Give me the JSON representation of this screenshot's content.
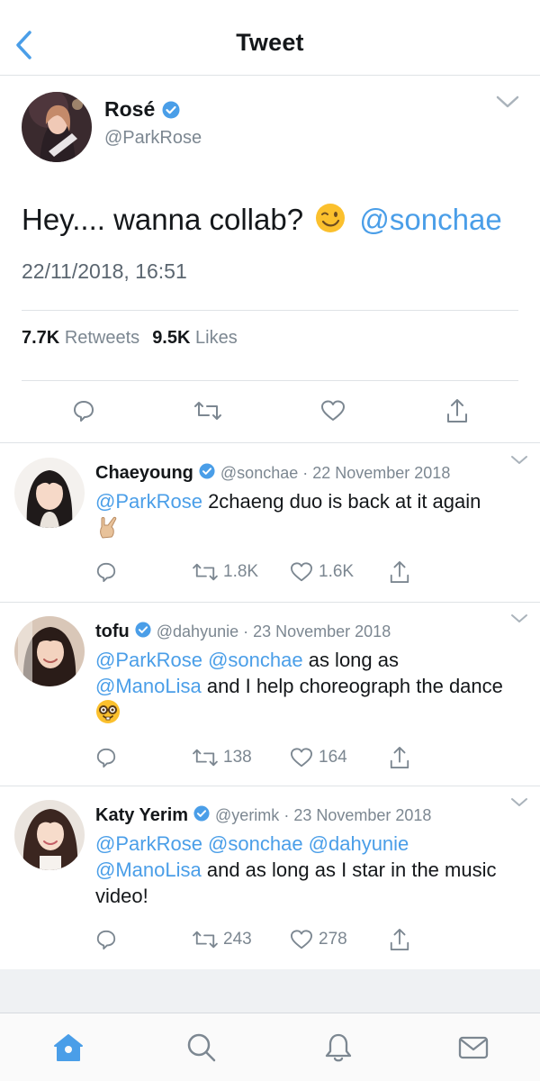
{
  "header": {
    "title": "Tweet"
  },
  "main_tweet": {
    "name": "Rosé",
    "handle": "@ParkRose",
    "text": "Hey.... wanna collab?",
    "emoji": "winking-face",
    "mention": "@sonchae",
    "datetime": "22/11/2018, 16:51",
    "retweets_count": "7.7K",
    "retweets_label": "Retweets",
    "likes_count": "9.5K",
    "likes_label": "Likes"
  },
  "replies": [
    {
      "name": "Chaeyoung",
      "handle": "@sonchae",
      "separator": "·",
      "date": "22 November 2018",
      "mentions": "@ParkRose",
      "text": "2chaeng duo is back at it again",
      "emoji": "sign-of-the-horns",
      "retweets": "1.8K",
      "likes": "1.6K"
    },
    {
      "name": "tofu",
      "handle": "@dahyunie",
      "separator": "·",
      "date": "23 November 2018",
      "mention_1": "@ParkRose",
      "mention_2": "@sonchae",
      "text_1": "as long as",
      "mention_3": "@ManoLisa",
      "text_2": "and I help choreograph the dance",
      "emoji": "nerd-face",
      "retweets": "138",
      "likes": "164"
    },
    {
      "name": "Katy Yerim",
      "handle": "@yerimk",
      "separator": "·",
      "date": "23 November 2018",
      "mentions_line": "@ParkRose @sonchae @dahyunie",
      "mention_last": "@ManoLisa",
      "text": "and as long as I star in the music video!",
      "retweets": "243",
      "likes": "278"
    }
  ],
  "colors": {
    "accent": "#4a9ee8",
    "muted": "#7c8791",
    "text": "#14171a"
  }
}
